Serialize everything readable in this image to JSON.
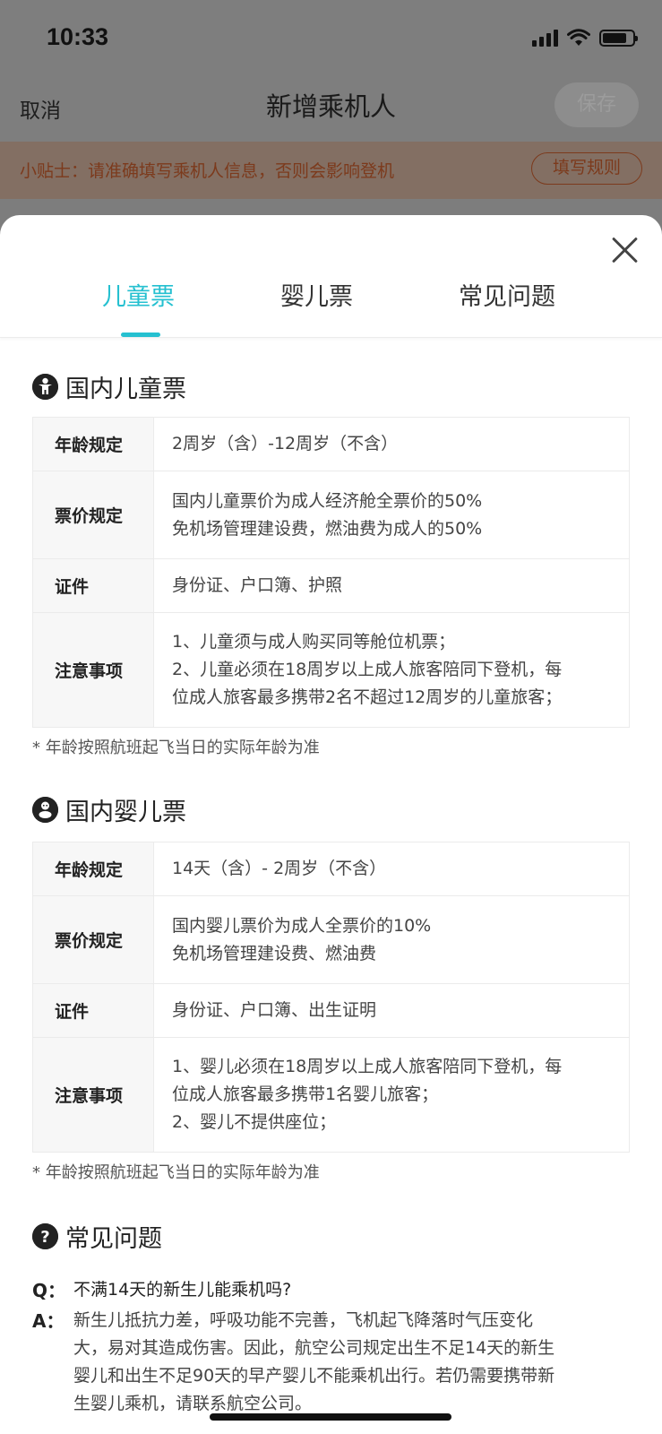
{
  "status_bar": {
    "time": "10:33"
  },
  "nav": {
    "cancel": "取消",
    "title": "新增乘机人",
    "save": "保存"
  },
  "tip": {
    "text": "小贴士：请准确填写乘机人信息，否则会影响登机",
    "rule_button": "填写规则"
  },
  "tabs": [
    {
      "label": "儿童票",
      "active": true
    },
    {
      "label": "婴儿票",
      "active": false
    },
    {
      "label": "常见问题",
      "active": false
    }
  ],
  "child_section": {
    "title": "国内儿童票",
    "rows": [
      {
        "key": "年龄规定",
        "lines": [
          "2周岁（含）-12周岁（不含）"
        ]
      },
      {
        "key": "票价规定",
        "lines": [
          "国内儿童票价为成人经济舱全票价的50%",
          "免机场管理建设费，燃油费为成人的50%"
        ]
      },
      {
        "key": "证件",
        "lines": [
          "身份证、户口簿、护照"
        ]
      },
      {
        "key": "注意事项",
        "lines": [
          "1、儿童须与成人购买同等舱位机票；",
          "2、儿童必须在18周岁以上成人旅客陪同下登机，每",
          "位成人旅客最多携带2名不超过12周岁的儿童旅客；"
        ]
      }
    ],
    "note": "* 年龄按照航班起飞当日的实际年龄为准"
  },
  "infant_section": {
    "title": "国内婴儿票",
    "rows": [
      {
        "key": "年龄规定",
        "lines": [
          "14天（含）- 2周岁（不含）"
        ]
      },
      {
        "key": "票价规定",
        "lines": [
          "国内婴儿票价为成人全票价的10%",
          "免机场管理建设费、燃油费"
        ]
      },
      {
        "key": "证件",
        "lines": [
          "身份证、户口簿、出生证明"
        ]
      },
      {
        "key": "注意事项",
        "lines": [
          "1、婴儿必须在18周岁以上成人旅客陪同下登机，每",
          "位成人旅客最多携带1名婴儿旅客；",
          "2、婴儿不提供座位；"
        ]
      }
    ],
    "note": "* 年龄按照航班起飞当日的实际年龄为准"
  },
  "faq_section": {
    "title": "常见问题",
    "q_mark": "Q：",
    "a_mark": "A：",
    "question": "不满14天的新生儿能乘机吗?",
    "answer_lines": [
      "新生儿抵抗力差，呼吸功能不完善，飞机起飞降落时气压变化",
      "大，易对其造成伤害。因此，航空公司规定出生不足14天的新生",
      "婴儿和出生不足90天的早产婴儿不能乘机出行。若仍需要携带新",
      "生婴儿乘机，请联系航空公司。"
    ]
  }
}
